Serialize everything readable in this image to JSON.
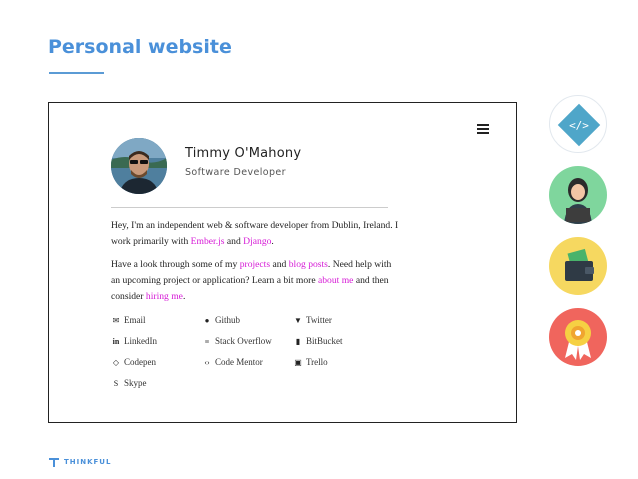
{
  "slide": {
    "title": "Personal website",
    "footer_brand": "THINKFUL"
  },
  "site": {
    "name": "Timmy O'Mahony",
    "role": "Software Developer",
    "intro": {
      "t1": "Hey, I'm an independent web & software developer from Dublin, Ireland. I work primarily with ",
      "l1": "Ember.js",
      "t2": " and ",
      "l2": "Django",
      "t3": "."
    },
    "cta": {
      "t1": "Have a look through some of my ",
      "l1": "projects",
      "t2": " and ",
      "l2": "blog posts",
      "t3": ". Need help with an upcoming project or application? Learn a bit more ",
      "l3": "about me",
      "t4": " and then consider ",
      "l4": "hiring me",
      "t5": "."
    },
    "links": [
      {
        "label": "Email",
        "icon": "envelope-icon"
      },
      {
        "label": "Github",
        "icon": "github-icon"
      },
      {
        "label": "Twitter",
        "icon": "twitter-icon"
      },
      {
        "label": "LinkedIn",
        "icon": "linkedin-icon"
      },
      {
        "label": "Stack Overflow",
        "icon": "stackoverflow-icon"
      },
      {
        "label": "BitBucket",
        "icon": "bitbucket-icon"
      },
      {
        "label": "Codepen",
        "icon": "codepen-icon"
      },
      {
        "label": "Code Mentor",
        "icon": "code-icon"
      },
      {
        "label": "Trello",
        "icon": "trello-icon"
      },
      {
        "label": "Skype",
        "icon": "skype-icon"
      }
    ]
  },
  "colors": {
    "accent": "#4a90d9",
    "link": "#d61ad6"
  }
}
